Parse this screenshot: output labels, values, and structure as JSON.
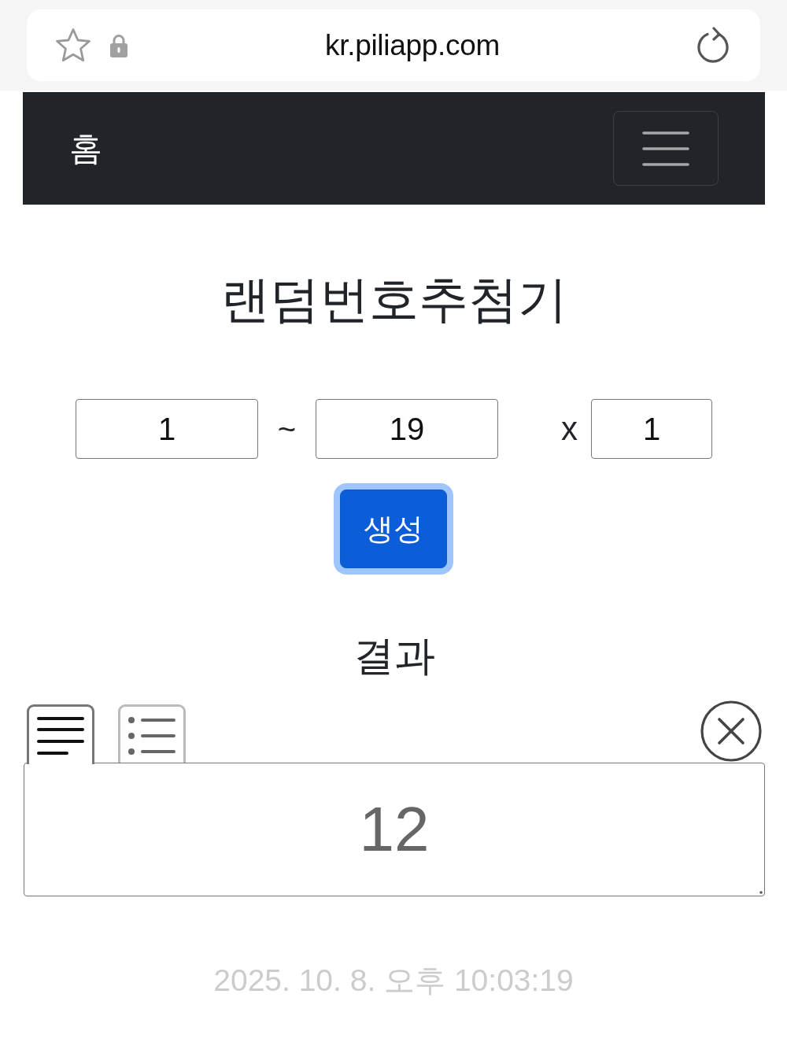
{
  "browser": {
    "url": "kr.piliapp.com"
  },
  "navbar": {
    "brand": "홈"
  },
  "title": "랜덤번호추첨기",
  "range": {
    "min": "1",
    "separator": "~",
    "max": "19",
    "times_label": "x",
    "count": "1"
  },
  "generate_button": {
    "label": "생성",
    "focused": true
  },
  "result": {
    "heading": "결과",
    "tabs": [
      {
        "kind": "lines",
        "selected": true
      },
      {
        "kind": "bullets",
        "selected": false
      }
    ],
    "value": "12"
  },
  "timestamp": "2025. 10. 8. 오후 10:03:19"
}
